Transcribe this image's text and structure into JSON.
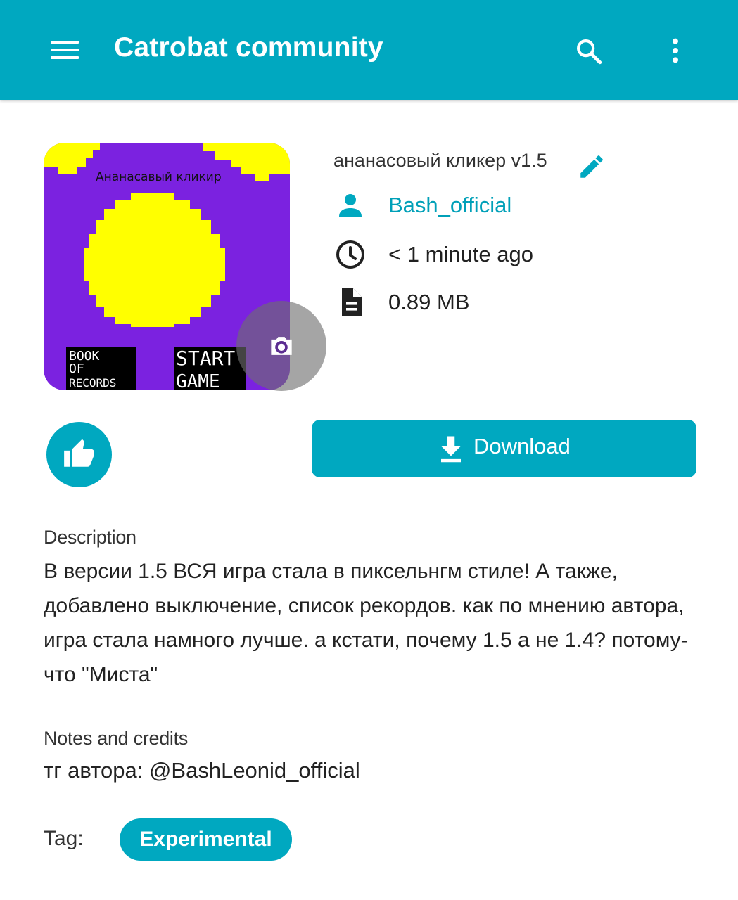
{
  "appbar": {
    "title": "Catrobat community",
    "menu_icon": "menu-icon",
    "search_icon": "search-icon",
    "more_icon": "more-vert-icon",
    "color": "#00a8c0"
  },
  "project": {
    "title": "ананасовый кликер v1.5",
    "author": "Bash_official",
    "uploaded": "< 1 minute ago",
    "size": "0.89 MB",
    "thumbnail": {
      "header_text": "Ананасавый кликир",
      "button_left": [
        "BOOK",
        "OF",
        "RECORDS"
      ],
      "button_right": [
        "START",
        "GAME"
      ],
      "bg_color": "#7b22e0",
      "accent_color": "#ffff00"
    }
  },
  "actions": {
    "download_label": "Download",
    "like_icon": "thumb-up-icon",
    "camera_icon": "camera-icon",
    "edit_icon": "pencil-icon"
  },
  "description": {
    "label": "Description",
    "text": "В версии 1.5 ВСЯ игра стала в пиксельнгм стиле! А также, добавлено выключение, список рекордов. как по мнению автора, игра стала намного лучше. а кстати, почему 1.5 а не 1.4? потому-что \"Миста\""
  },
  "notes": {
    "label": "Notes and credits",
    "text": "тг автора: @BashLeonid_official"
  },
  "tags": {
    "label": "Tag:",
    "items": [
      "Experimental"
    ]
  }
}
